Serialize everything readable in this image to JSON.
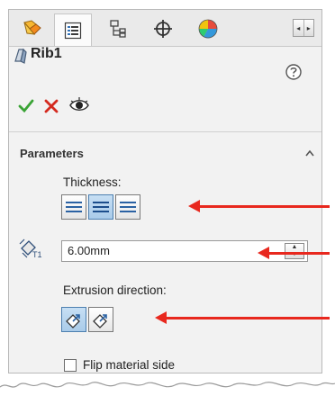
{
  "property_manager": {
    "title": "Rib1",
    "tabs": [
      {
        "name": "featuremanager-tab",
        "icon": "feature-tree-icon"
      },
      {
        "name": "propertymanager-tab",
        "icon": "property-manager-icon",
        "active": true
      },
      {
        "name": "configurationmanager-tab",
        "icon": "configuration-icon"
      },
      {
        "name": "dimxpert-tab",
        "icon": "dimxpert-icon"
      },
      {
        "name": "display-manager-tab",
        "icon": "display-manager-icon"
      }
    ],
    "actions": [
      "ok",
      "cancel",
      "preview"
    ]
  },
  "parameters": {
    "section_label": "Parameters",
    "thickness": {
      "label": "Thickness:",
      "options": [
        "first-side",
        "both-sides",
        "second-side"
      ],
      "selected": "both-sides"
    },
    "thickness_value": "6.00mm",
    "extrusion": {
      "label": "Extrusion direction:",
      "options": [
        "parallel-to-sketch",
        "normal-to-sketch"
      ],
      "selected": "parallel-to-sketch"
    },
    "flip_label": "Flip material side",
    "flip_checked": false
  },
  "colors": {
    "accent_arrow": "#e8281e",
    "ok_green": "#3aa335",
    "cancel_red": "#d42a1f",
    "selected_button": "#a9cbe9"
  }
}
